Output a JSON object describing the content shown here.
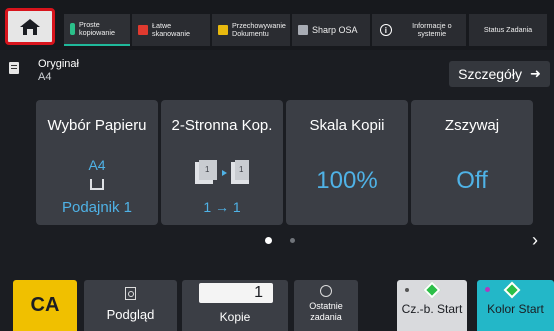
{
  "topbar": {
    "home_icon": "home-icon",
    "tabs": [
      {
        "label": "Proste kopiowanie",
        "icon": "copy-icon",
        "active": true
      },
      {
        "label": "Łatwe skanowanie",
        "icon": "scan-icon"
      },
      {
        "label": "Przechowywanie Dokumentu",
        "icon": "folder-icon"
      },
      {
        "label": "Sharp OSA",
        "icon": "osa-icon"
      },
      {
        "label": "Informacje o systemie",
        "icon": "info-icon"
      },
      {
        "label": "Status Zadania"
      }
    ]
  },
  "original": {
    "label": "Oryginał",
    "value": "A4",
    "details_label": "Szczegóły"
  },
  "cards": {
    "paper": {
      "title": "Wybór Papieru",
      "size": "A4",
      "tray": "Podajnik 1"
    },
    "duplex": {
      "title": "2-Stronna Kop.",
      "value": "1 → 1"
    },
    "scale": {
      "title": "Skala Kopii",
      "value": "100%"
    },
    "staple": {
      "title": "Zszywaj",
      "value": "Off"
    }
  },
  "pager": {
    "current": 1,
    "total": 2
  },
  "bottom": {
    "ca_label": "CA",
    "preview_label": "Podgląd",
    "copies_value": "1",
    "copies_label": "Kopie",
    "recent_label": "Ostatnie zadania",
    "bw_start": "Cz.-b. Start",
    "color_start": "Kolor Start"
  },
  "colors": {
    "accent_blue": "#4fb2e6",
    "ca_yellow": "#f0c000",
    "color_start": "#23b7c8",
    "home_border": "#d8141c"
  }
}
